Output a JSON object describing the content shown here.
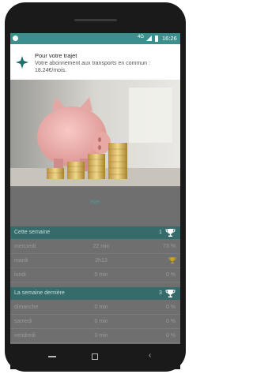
{
  "status_bar": {
    "network": "4G",
    "time": "16:26"
  },
  "notification": {
    "title": "Pour votre trajet",
    "body": "Votre abonnement aux transports en commun : 18.24€/mois."
  },
  "app": {
    "yesterday_label": "Hier",
    "this_week": {
      "label": "Cette semaine",
      "count": "1",
      "rows": [
        {
          "day": "mercredi",
          "duration": "22 min",
          "percent": "73 %"
        },
        {
          "day": "mardi",
          "duration": "2h13",
          "percent": ""
        },
        {
          "day": "lundi",
          "duration": "0 min",
          "percent": "0 %"
        }
      ]
    },
    "last_week": {
      "label": "La semaine dernière",
      "count": "3",
      "rows": [
        {
          "day": "dimanche",
          "duration": "0 min",
          "percent": "0 %"
        },
        {
          "day": "samedi",
          "duration": "0 min",
          "percent": "0 %"
        },
        {
          "day": "vendredi",
          "duration": "0 min",
          "percent": "0 %"
        }
      ]
    }
  },
  "colors": {
    "accent": "#3b8f8c",
    "header": "#356b6b",
    "trophy": "#c9a227"
  }
}
